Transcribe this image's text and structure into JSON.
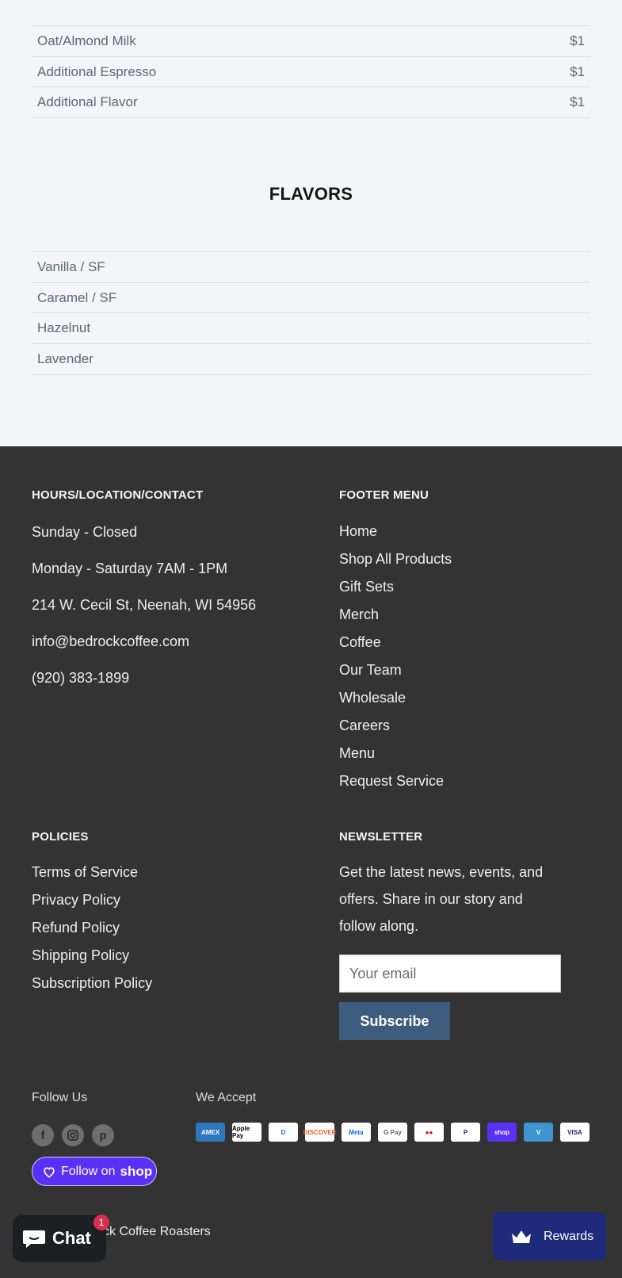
{
  "addons": [
    {
      "name": "Oat/Almond Milk",
      "price": "$1"
    },
    {
      "name": "Additional Espresso",
      "price": "$1"
    },
    {
      "name": "Additional Flavor",
      "price": "$1"
    }
  ],
  "flavors": {
    "title": "FLAVORS",
    "items": [
      "Vanilla / SF",
      "Caramel / SF",
      "Hazelnut",
      "Lavender"
    ]
  },
  "footer": {
    "contact": {
      "heading": "HOURS/LOCATION/CONTACT",
      "lines": [
        "Sunday - Closed",
        "Monday - Saturday 7AM - 1PM",
        "214 W. Cecil St, Neenah, WI 54956",
        "info@bedrockcoffee.com",
        "(920) 383-1899"
      ]
    },
    "menu": {
      "heading": "FOOTER MENU",
      "items": [
        "Home",
        "Shop All Products",
        "Gift Sets",
        "Merch",
        "Coffee",
        "Our Team",
        "Wholesale",
        "Careers",
        "Menu",
        "Request Service"
      ]
    },
    "policies": {
      "heading": "POLICIES",
      "items": [
        "Terms of Service",
        "Privacy Policy",
        "Refund Policy",
        "Shipping Policy",
        "Subscription Policy"
      ]
    },
    "newsletter": {
      "heading": "NEWSLETTER",
      "text": "Get the latest news, events, and offers. Share in our story and follow along.",
      "placeholder": "Your email",
      "button": "Subscribe"
    },
    "follow_heading": "Follow Us",
    "social_icons": [
      "facebook-icon",
      "instagram-icon",
      "pinterest-icon"
    ],
    "shop_follow": {
      "label": "Follow on",
      "brand": "shop"
    },
    "accept_heading": "We Accept",
    "payments": [
      {
        "label": "AMEX",
        "bg": "#2e77bc",
        "fg": "#ffffff"
      },
      {
        "label": "Apple Pay",
        "bg": "#ffffff",
        "fg": "#000000"
      },
      {
        "label": "D",
        "bg": "#ffffff",
        "fg": "#0079be"
      },
      {
        "label": "DISCOVER",
        "bg": "#ffffff",
        "fg": "#e65c24"
      },
      {
        "label": "Meta",
        "bg": "#ffffff",
        "fg": "#0668e1"
      },
      {
        "label": "G Pay",
        "bg": "#ffffff",
        "fg": "#5f6368"
      },
      {
        "label": "●●",
        "bg": "#ffffff",
        "fg": "#eb001b"
      },
      {
        "label": "P",
        "bg": "#ffffff",
        "fg": "#003087"
      },
      {
        "label": "shop",
        "bg": "#5a31f4",
        "fg": "#ffffff"
      },
      {
        "label": "V",
        "bg": "#3d95ce",
        "fg": "#ffffff"
      },
      {
        "label": "VISA",
        "bg": "#ffffff",
        "fg": "#1a1f71"
      }
    ],
    "copyright": "ck Coffee Roasters"
  },
  "chat": {
    "label": "Chat",
    "badge": "1"
  },
  "rewards": {
    "label": "Rewards"
  },
  "colors": {
    "footer_bg": "#333333",
    "subscribe_bg": "#3d5c7e",
    "shop_purple": "#5a31f4",
    "rewards_bg": "#1e2a7a"
  }
}
